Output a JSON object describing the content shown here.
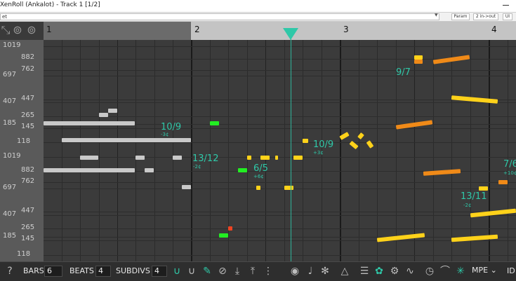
{
  "window": {
    "title": "XenRoll (Ankalot) - Track 1 [1/2]"
  },
  "host": {
    "preset": "et",
    "params_button": "Param",
    "routing_button": "2 in->out",
    "ui_button": "UI"
  },
  "ruler": {
    "bars": [
      "1",
      "2",
      "3",
      "4"
    ]
  },
  "pitch_labels": [
    "1019",
    "882",
    "762",
    "697",
    "447",
    "407",
    "265",
    "185",
    "145",
    "118",
    "1019",
    "882",
    "762",
    "697",
    "447",
    "407",
    "265",
    "185",
    "145",
    "118"
  ],
  "ratios": [
    {
      "text": "10/9",
      "cents": "-3¢"
    },
    {
      "text": "13/12",
      "cents": "-2¢"
    },
    {
      "text": "6/5",
      "cents": "+6¢"
    },
    {
      "text": "10/9",
      "cents": "+3¢"
    },
    {
      "text": "9/7",
      "cents": ""
    },
    {
      "text": "13/11",
      "cents": "-2¢"
    },
    {
      "text": "7/6",
      "cents": "+10¢"
    }
  ],
  "toolbar": {
    "bars_label": "BARS",
    "bars_value": "6",
    "beats_label": "BEATS",
    "beats_value": "4",
    "subdivs_label": "SUBDIVS",
    "subdivs_value": "4",
    "mode_label": "MPE",
    "last_label": "ID"
  },
  "colors": {
    "accent": "#2fc8a8",
    "note_grey": "#c9c9c9",
    "note_green": "#22ee22",
    "note_yellow": "#ffd21a",
    "note_orange": "#f08a18"
  },
  "icons": [
    "help-icon",
    "magnet-icon",
    "magnet-outline-icon",
    "pencil-icon",
    "mute-pen-icon",
    "download-icon",
    "upload-icon",
    "more-icon",
    "record-icon",
    "mic-icon",
    "spectrum-icon",
    "triangle-icon",
    "list-icon",
    "palette-icon",
    "gear-icon",
    "waveform-icon",
    "tempo-icon",
    "lens-icon",
    "tuning-icon"
  ]
}
